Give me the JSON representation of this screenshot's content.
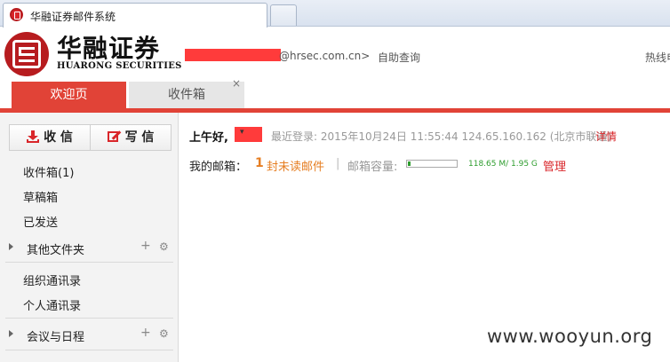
{
  "browser": {
    "tab_title": "华融证券邮件系统"
  },
  "header": {
    "logo_cn": "华融证券",
    "logo_en": "HUARONG SECURITIES",
    "user_email_suffix": "@hrsec.com.cn>",
    "auto_query": "自助查询",
    "hotline": "热线电"
  },
  "tabs": [
    {
      "label": "欢迎页",
      "active": true
    },
    {
      "label": "收件箱",
      "active": false,
      "close": "×"
    }
  ],
  "sidebar": {
    "receive_label": "收 信",
    "write_label": "写 信",
    "items": [
      {
        "label": "收件箱(1)"
      },
      {
        "label": "草稿箱"
      },
      {
        "label": "已发送"
      }
    ],
    "other_folders": "其他文件夹",
    "contacts_org": "组织通讯录",
    "contacts_personal": "个人通讯录",
    "calendar": "会议与日程",
    "plus": "+",
    "gear": "⚙"
  },
  "main": {
    "greeting": "上午好,",
    "last_login": "最近登录: 2015年10月24日 11:55:44 124.65.160.162 (北京市联通)",
    "detail_link": "详情",
    "mailbox_label": "我的邮箱：",
    "unread_count": "1",
    "unread_text": "封未读邮件",
    "separator": "|",
    "quota_label": "邮箱容量:",
    "quota_text": "118.65 M/ 1.95 G",
    "quota_fraction": 0.06,
    "manage_link": "管理"
  },
  "watermark": "www.wooyun.org",
  "colors": {
    "accent": "#e14337",
    "redaction": "#ff3b3b",
    "unread": "#e67e22",
    "quota": "#2e9d2e"
  }
}
